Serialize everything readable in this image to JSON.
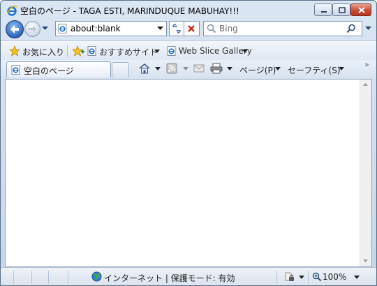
{
  "window": {
    "title": "空白のページ - TAGA ESTI, MARINDUQUE MABUHAY!!!"
  },
  "navigation": {
    "address": "about:blank",
    "search_placeholder": "Bing"
  },
  "favorites_bar": {
    "favorites_label": "お気に入り",
    "items": [
      {
        "label": "おすすめサイト",
        "icon": "ie-page-icon"
      },
      {
        "label": "Web Slice Gallery",
        "icon": "ie-page-icon"
      }
    ]
  },
  "tabs": [
    {
      "label": "空白のページ",
      "icon": "ie-page-icon"
    }
  ],
  "command_bar": {
    "page_menu": "ページ(P)",
    "safety_menu": "セーフティ(S)",
    "icons": [
      "home-icon",
      "rss-feeds-icon",
      "read-mail-icon",
      "print-icon"
    ]
  },
  "status_bar": {
    "zone": "インターネット | 保護モード: 有効",
    "zoom": "100%"
  },
  "colors": {
    "chrome": "#dbe6f3",
    "accent_blue": "#2e66b8",
    "close_red": "#c94b34"
  }
}
